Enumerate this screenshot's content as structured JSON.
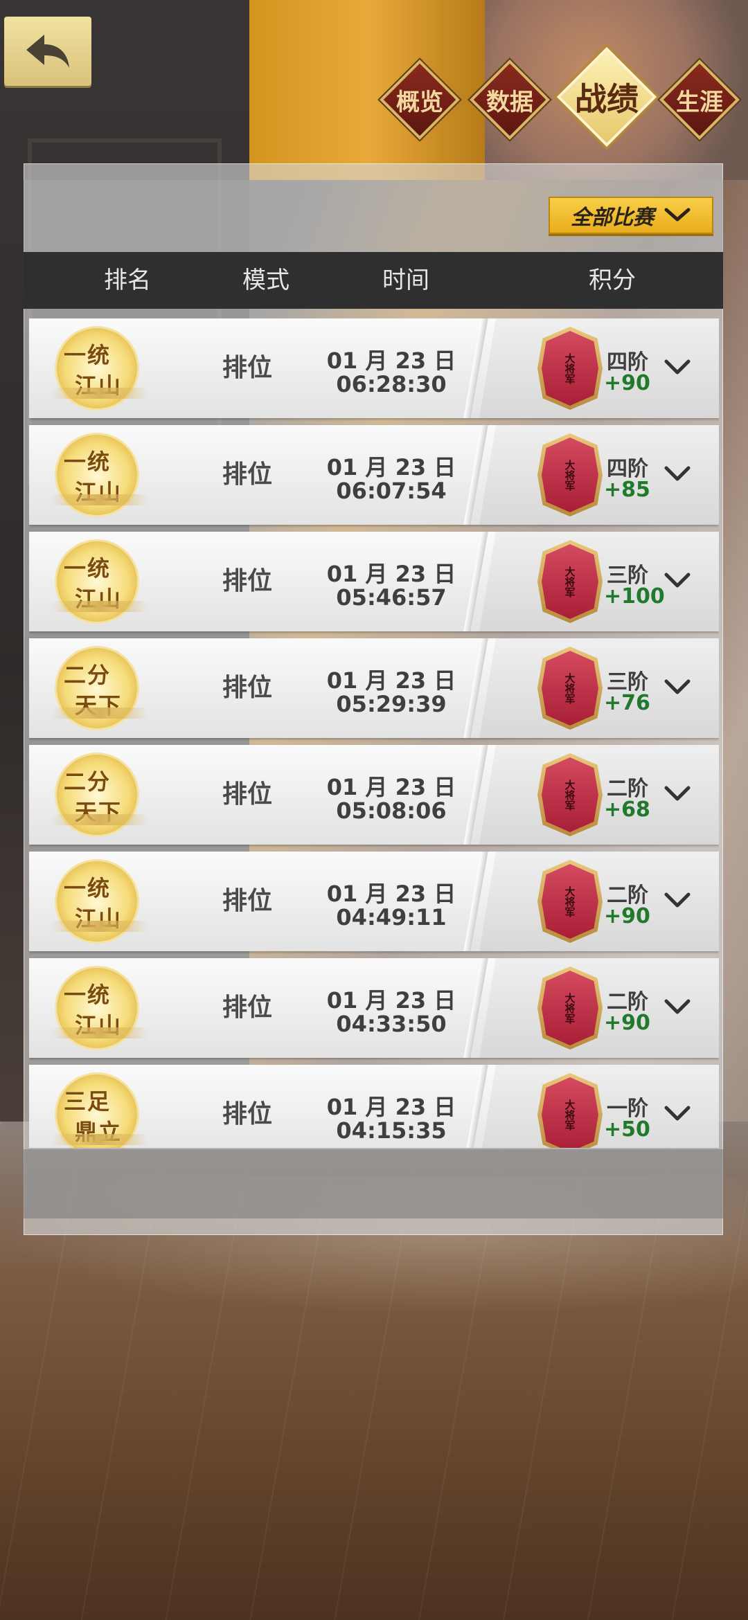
{
  "tabs": [
    {
      "label": "概览",
      "active": false
    },
    {
      "label": "数据",
      "active": false
    },
    {
      "label": "战绩",
      "active": true
    },
    {
      "label": "生涯",
      "active": false
    }
  ],
  "filter": {
    "label": "全部比赛"
  },
  "columns": [
    "排名",
    "模式",
    "时间",
    "积分"
  ],
  "rows": [
    {
      "rank_badge": [
        "一统",
        "江山"
      ],
      "mode": "排位",
      "date": "01 月 23 日",
      "time": "06:28:30",
      "tier": "四阶",
      "points": "+90"
    },
    {
      "rank_badge": [
        "一统",
        "江山"
      ],
      "mode": "排位",
      "date": "01 月 23 日",
      "time": "06:07:54",
      "tier": "四阶",
      "points": "+85"
    },
    {
      "rank_badge": [
        "一统",
        "江山"
      ],
      "mode": "排位",
      "date": "01 月 23 日",
      "time": "05:46:57",
      "tier": "三阶",
      "points": "+100"
    },
    {
      "rank_badge": [
        "二分",
        "天下"
      ],
      "mode": "排位",
      "date": "01 月 23 日",
      "time": "05:29:39",
      "tier": "三阶",
      "points": "+76"
    },
    {
      "rank_badge": [
        "二分",
        "天下"
      ],
      "mode": "排位",
      "date": "01 月 23 日",
      "time": "05:08:06",
      "tier": "二阶",
      "points": "+68"
    },
    {
      "rank_badge": [
        "一统",
        "江山"
      ],
      "mode": "排位",
      "date": "01 月 23 日",
      "time": "04:49:11",
      "tier": "二阶",
      "points": "+90"
    },
    {
      "rank_badge": [
        "一统",
        "江山"
      ],
      "mode": "排位",
      "date": "01 月 23 日",
      "time": "04:33:50",
      "tier": "二阶",
      "points": "+90"
    },
    {
      "rank_badge": [
        "三足",
        "鼎立"
      ],
      "mode": "排位",
      "date": "01 月 23 日",
      "time": "04:15:35",
      "tier": "一阶",
      "points": "+50"
    }
  ],
  "shield_glyph": "大将军",
  "colors": {
    "points_green": "#217a2c",
    "filter_gold": "#f0bd2e",
    "tab_red": "#7a2218"
  }
}
